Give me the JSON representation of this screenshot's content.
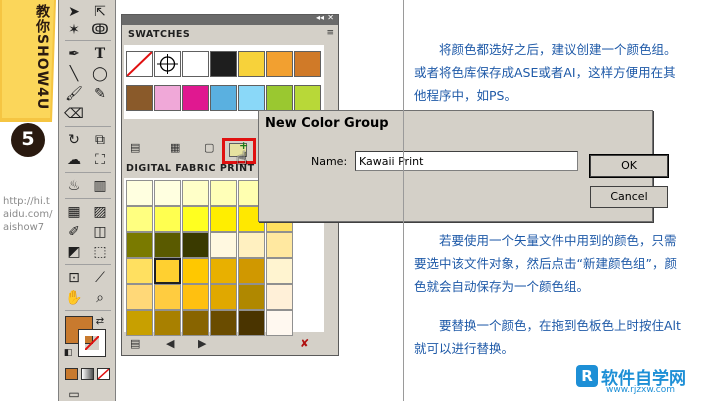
{
  "banner": {
    "vertical_text": "教你SHOW4U",
    "step_number": "5",
    "url_lines": [
      "http://hi.t",
      "aidu.com/",
      "aishow7"
    ]
  },
  "tools": {
    "icons": [
      "selection-tool",
      "direct-selection-tool",
      "magic-wand-tool",
      "lasso-tool",
      "pen-tool",
      "type-tool",
      "line-tool",
      "ellipse-tool",
      "paintbrush-tool",
      "pencil-tool",
      "eraser-tool",
      "rotate-tool",
      "scale-tool",
      "warp-tool",
      "free-transform-tool",
      "symbol-sprayer-tool",
      "column-graph-tool",
      "mesh-tool",
      "gradient-tool",
      "eyedropper-tool",
      "blend-tool",
      "live-paint-tool",
      "live-paint-selection-tool",
      "crop-tool",
      "slice-tool",
      "hand-tool",
      "zoom-tool"
    ],
    "fill_color": "#c87a2e",
    "stroke_color": "#ffffff"
  },
  "swatches_panel": {
    "tab_label": "SWATCHES",
    "menu_glyph": "≡",
    "swatches_row1": [
      "none",
      "registration",
      "#ffffff",
      "#1e1e1e",
      "#f7d23a",
      "#f2a030",
      "#d07a28"
    ],
    "swatches_row2": [
      "#8a5a2a",
      "#f0a8d8",
      "#e01890",
      "#5ab0e0",
      "#8ad8f8",
      "#9ac830",
      "#b8d838"
    ],
    "library_title": "DIGITAL FABRIC PRINT",
    "library_rows": [
      [
        "#ffffe0",
        "#ffffe0",
        "#ffffc8",
        "#ffffb8",
        "#ffffb0",
        "#ffffa8"
      ],
      [
        "#ffff80",
        "#ffff50",
        "#ffff20",
        "#ffee00",
        "#ffe800",
        "#ffe060"
      ],
      [
        "#7a7a00",
        "#5a5a00",
        "#3a3a00",
        "#fff8e0",
        "#fff0c0",
        "#ffe8a0"
      ],
      [
        "#ffe060",
        "#ffd030",
        "#ffc800",
        "#e8b000",
        "#d09800",
        "#fff4d0"
      ],
      [
        "#ffd878",
        "#ffcc40",
        "#ffc010",
        "#e0a800",
        "#b08800",
        "#fff0d8"
      ],
      [
        "#c8a000",
        "#a88000",
        "#886400",
        "#6a4c00",
        "#4a3400",
        "#fff8f0"
      ]
    ],
    "selected_row": 3,
    "selected_col": 1
  },
  "dialog": {
    "title": "New Color Group",
    "name_label": "Name:",
    "name_value": "Kawaii Print",
    "ok_label": "OK",
    "cancel_label": "Cancel"
  },
  "text": {
    "para1": "将颜色都选好之后，建议创建一个颜色组。或者将色库保存成ASE或者AI，这样方便用在其他程序中，如PS。",
    "para2": "若要使用一个矢量文件中用到的颜色，只需要选中该文件对象，然后点击“新建颜色组”，颜色就会自动保存为一个颜色组。",
    "para3": "要替换一个颜色，在拖到色板色上时按住Alt就可以进行替换。"
  },
  "watermark": {
    "logo_letter": "R",
    "name": "软件自学网",
    "url": "www.rjzxw.com"
  }
}
